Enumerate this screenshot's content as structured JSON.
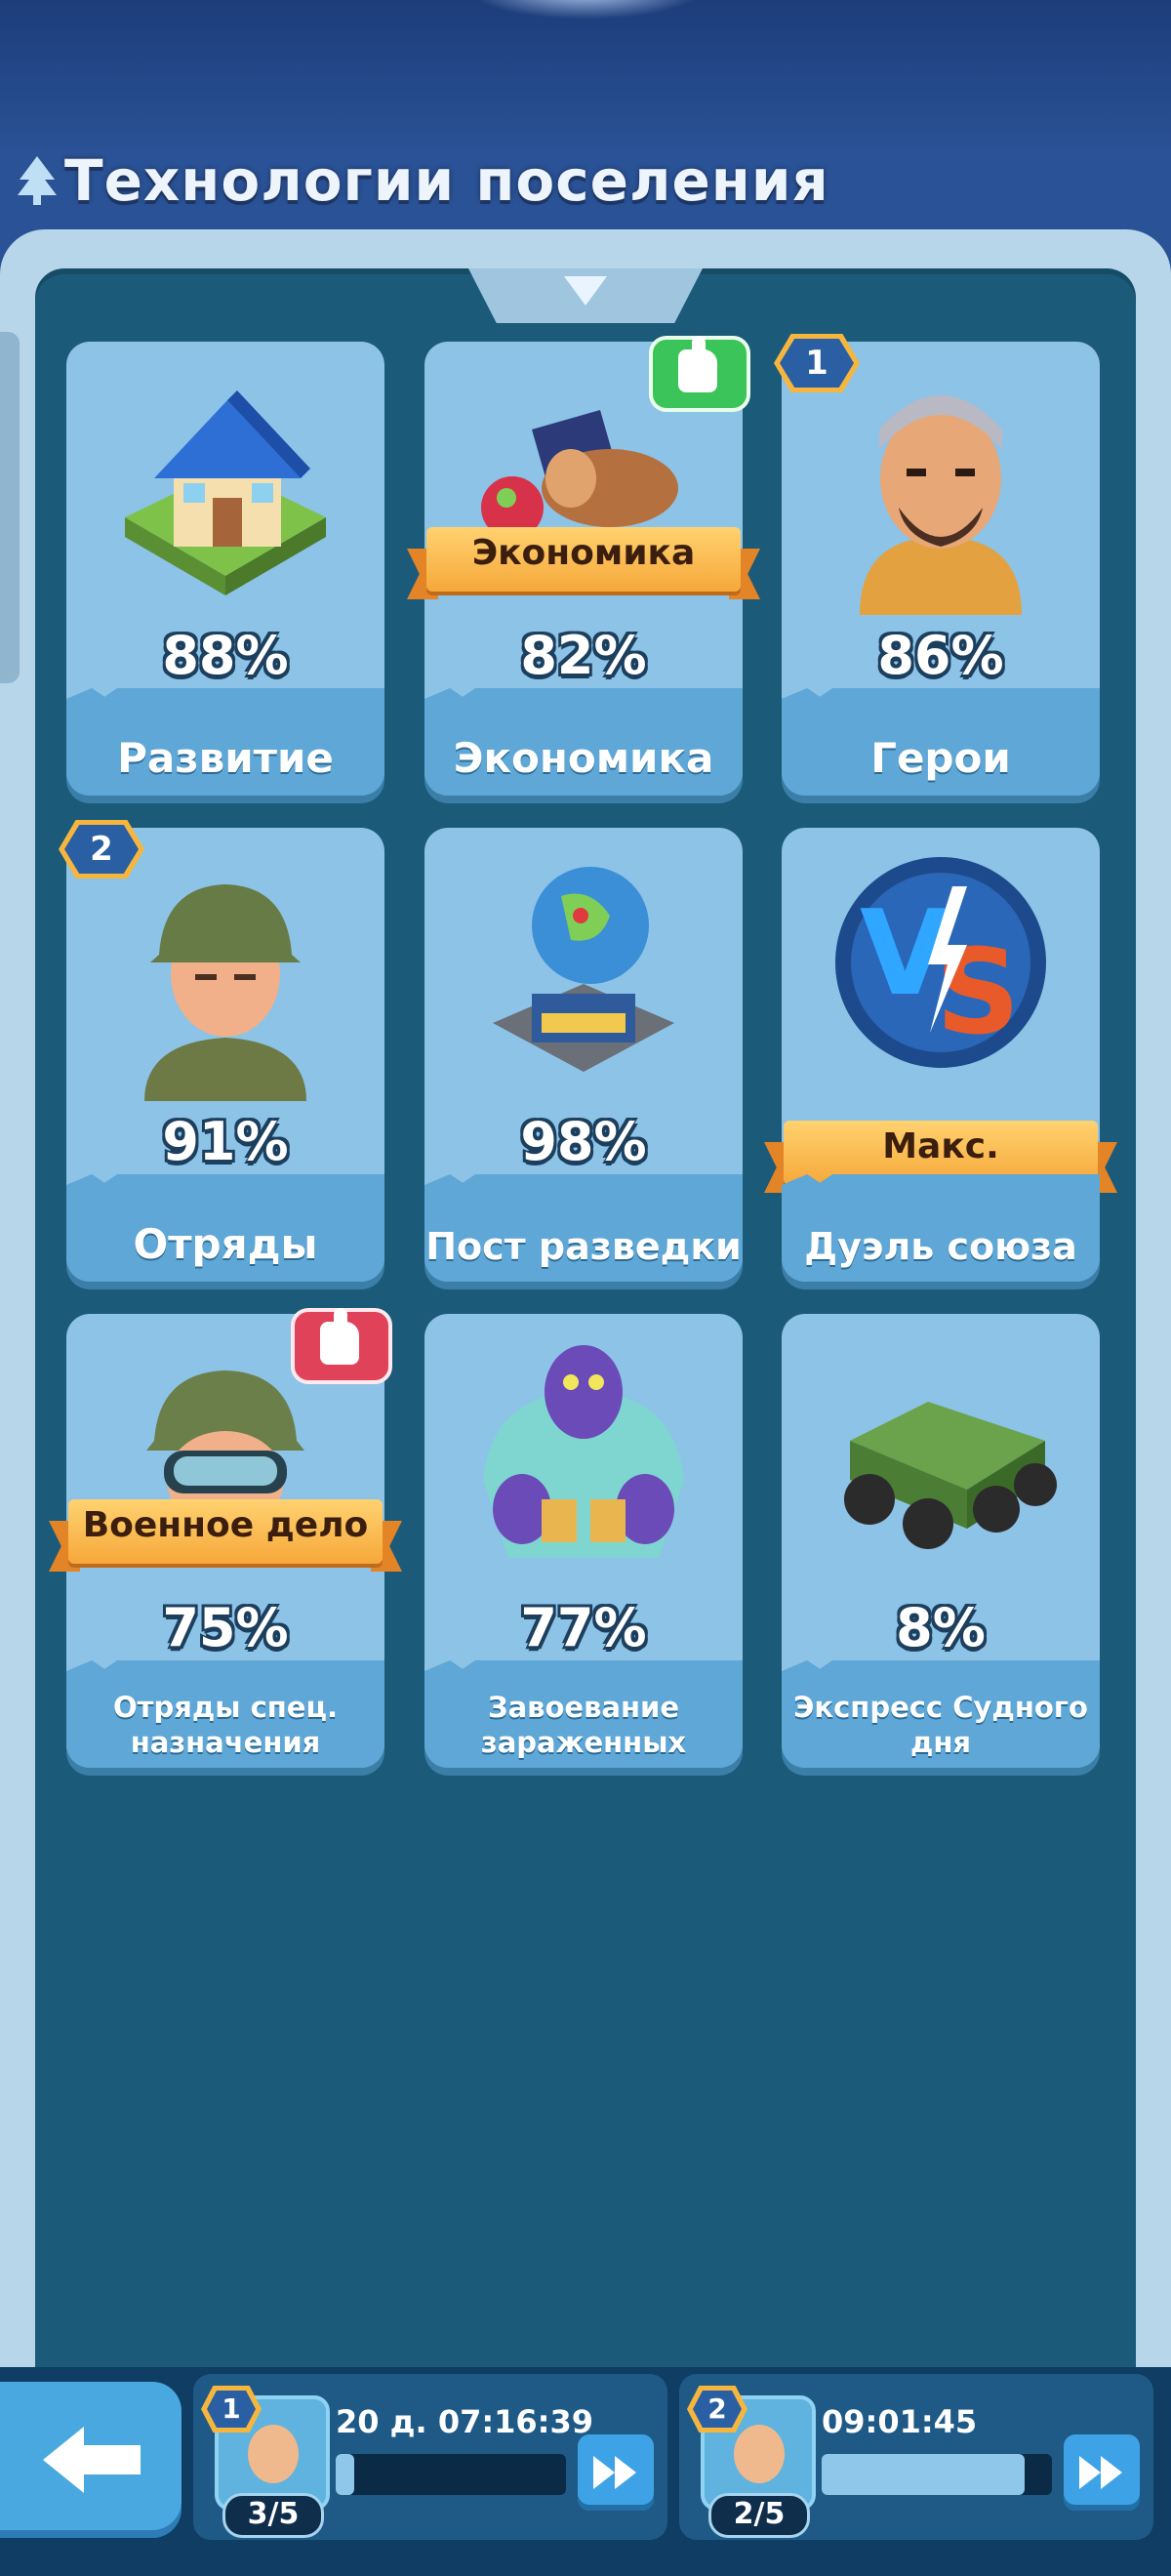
{
  "header": {
    "title": "Технологии поселения",
    "icon": "tree-icon"
  },
  "cards": [
    {
      "id": "development",
      "percent": "88%",
      "name": "Развитие",
      "icon": "house-icon"
    },
    {
      "id": "economy",
      "percent": "82%",
      "name": "Экономика",
      "ribbon": "Экономика",
      "icon": "resources-icon",
      "recommend": "green"
    },
    {
      "id": "heroes",
      "percent": "86%",
      "name": "Герои",
      "badge": "1",
      "icon": "hero-portrait-icon"
    },
    {
      "id": "squads",
      "percent": "91%",
      "name": "Отряды",
      "badge": "2",
      "icon": "soldier-icon"
    },
    {
      "id": "recon",
      "percent": "98%",
      "name": "Пост разведки",
      "icon": "globe-icon"
    },
    {
      "id": "duel",
      "percent": "",
      "name": "Дуэль союза",
      "ribbon": "Макс.",
      "icon": "vs-icon"
    },
    {
      "id": "special",
      "percent": "75%",
      "name": "Отряды спец. назначения",
      "ribbon": "Военное дело",
      "icon": "goggles-soldier-icon",
      "recommend": "red"
    },
    {
      "id": "infected",
      "percent": "77%",
      "name": "Завоевание зараженных",
      "icon": "zombie-icon"
    },
    {
      "id": "express",
      "percent": "8%",
      "name": "Экспресс Судного дня",
      "icon": "truck-icon"
    }
  ],
  "bottom": {
    "back_icon": "back-arrow-icon",
    "slots": [
      {
        "badge": "1",
        "timer": "20 д. 07:16:39",
        "count": "3/5",
        "progress": 0.08
      },
      {
        "badge": "2",
        "timer": "09:01:45",
        "count": "2/5",
        "progress": 0.88
      }
    ]
  },
  "colors": {
    "accent": "#f6a83a",
    "panel": "#1c5a79",
    "card": "#8cc3e6",
    "green": "#3bc45a",
    "red": "#e0425a"
  }
}
